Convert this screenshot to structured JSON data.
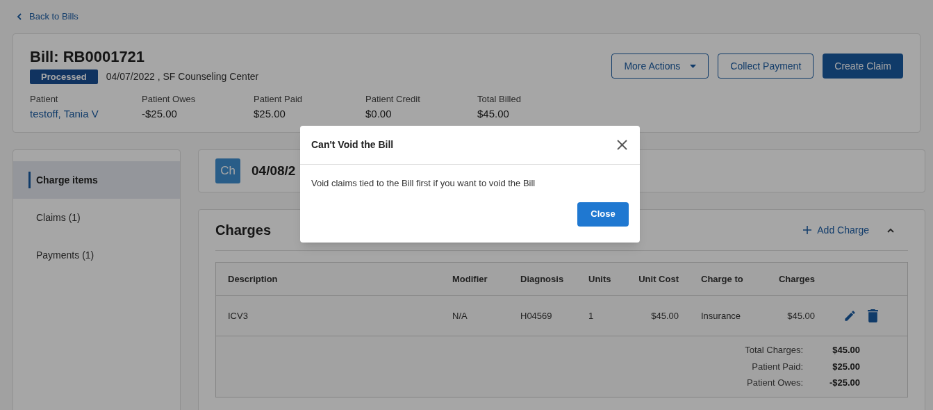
{
  "back_link": "Back to Bills",
  "bill": {
    "title": "Bill: RB0001721",
    "status": "Processed",
    "subtitle": "04/07/2022 , SF Counseling Center",
    "stats": [
      {
        "label": "Patient",
        "value": "testoff, Tania V",
        "kind": "link"
      },
      {
        "label": "Patient Owes",
        "value": "-$25.00",
        "kind": "plain"
      },
      {
        "label": "Patient Paid",
        "value": "$25.00",
        "kind": "plain"
      },
      {
        "label": "Patient Credit",
        "value": "$0.00",
        "kind": "plain"
      },
      {
        "label": "Total Billed",
        "value": "$45.00",
        "kind": "plain"
      }
    ],
    "actions": [
      {
        "label": "More Actions",
        "kind": "dropdown"
      },
      {
        "label": "Collect Payment",
        "kind": "outline"
      },
      {
        "label": "Create Claim",
        "kind": "primary"
      }
    ]
  },
  "sidebar": {
    "items": [
      {
        "label": "Charge items",
        "selected": true
      },
      {
        "label": "Claims (1)",
        "selected": false
      },
      {
        "label": "Payments (1)",
        "selected": false
      }
    ]
  },
  "encounter": {
    "avatar": "Ch",
    "date": "04/08/2"
  },
  "charges": {
    "title": "Charges",
    "add_label": "Add Charge",
    "columns": [
      "Description",
      "Modifier",
      "Diagnosis",
      "Units",
      "Unit Cost",
      "Charge to",
      "Charges"
    ],
    "rows": [
      [
        "ICV3",
        "N/A",
        "H04569",
        "1",
        "$45.00",
        "Insurance",
        "$45.00"
      ]
    ],
    "totals": [
      {
        "label": "Total Charges:",
        "value": "$45.00"
      },
      {
        "label": "Patient Paid:",
        "value": "$25.00"
      },
      {
        "label": "Patient Owes:",
        "value": "-$25.00"
      }
    ]
  },
  "dialog": {
    "title": "Can't Void the Bill",
    "message": "Void claims tied to the Bill first if you want to void the Bill",
    "button": "Close"
  }
}
